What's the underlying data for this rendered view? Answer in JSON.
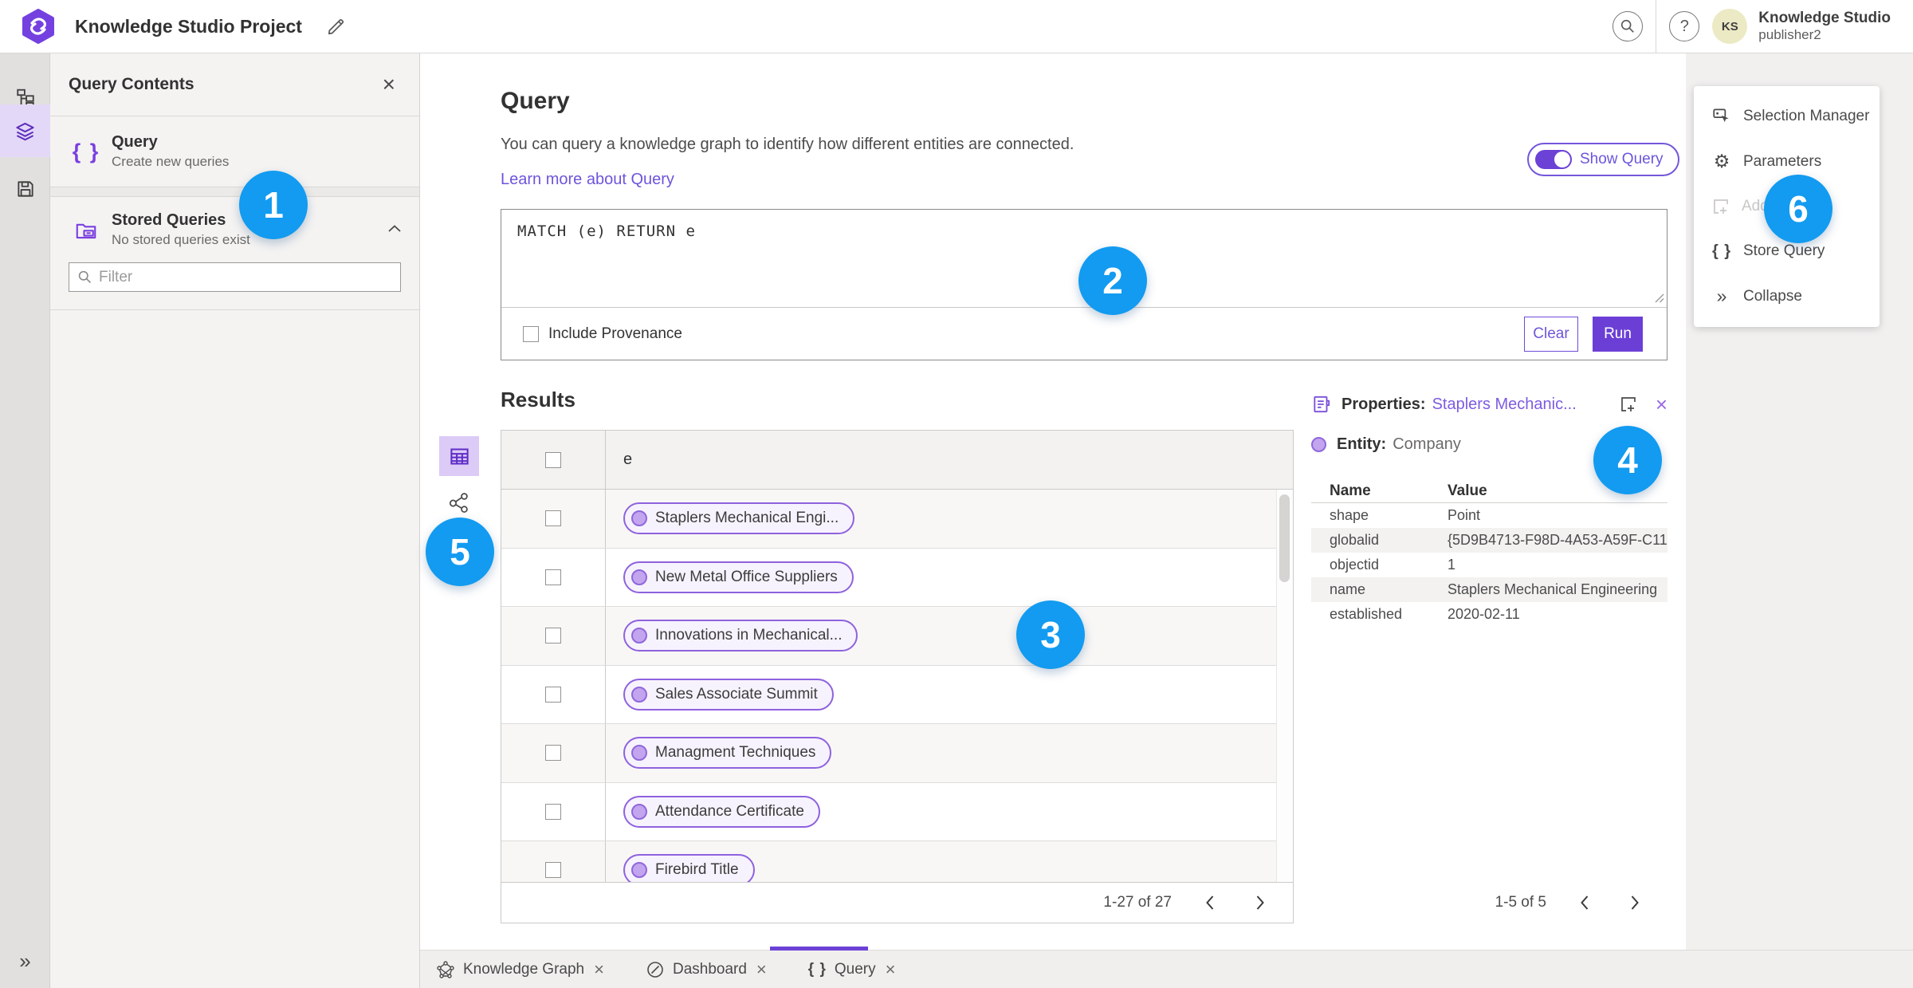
{
  "colors": {
    "accent_purple": "#6C41D6",
    "link_purple": "#6D55DB",
    "pill_border": "#8E62DD",
    "pill_dot": "#C3A4EE",
    "selected_light_purple": "#DCCBF6",
    "annotation_blue": "#129BF0",
    "avatar_bg": "#ECEAC4"
  },
  "icons": {
    "braces": "{ }",
    "close": "×",
    "collapse_chevrons": "»",
    "gear": "⚙",
    "question_mark": "?"
  },
  "topbar": {
    "title": "Knowledge Studio Project",
    "user_name": "Knowledge Studio",
    "user_sub": "publisher2",
    "avatar_initials": "KS"
  },
  "query_contents": {
    "title": "Query Contents",
    "query_item": {
      "title": "Query",
      "subtitle": "Create new queries"
    },
    "stored_item": {
      "title": "Stored Queries",
      "subtitle": "No stored queries exist"
    },
    "filter_placeholder": "Filter"
  },
  "query_section": {
    "title": "Query",
    "description": "You can query a knowledge graph to identify how different entities are connected.",
    "learn_more": "Learn more about Query",
    "show_query_label": "Show Query",
    "query_text": "MATCH (e) RETURN e",
    "include_provenance_label": "Include Provenance",
    "clear_label": "Clear",
    "run_label": "Run"
  },
  "results": {
    "title": "Results",
    "column_header": "e",
    "rows": [
      {
        "label": "Staplers Mechanical Engi..."
      },
      {
        "label": "New Metal Office Suppliers"
      },
      {
        "label": "Innovations in Mechanical..."
      },
      {
        "label": "Sales Associate Summit"
      },
      {
        "label": "Managment Techniques"
      },
      {
        "label": "Attendance Certificate"
      },
      {
        "label": "Firebird Title"
      }
    ],
    "pagination": "1-27 of 27"
  },
  "properties": {
    "heading": "Properties:",
    "entity_link": "Staplers Mechanic...",
    "entity_label": "Entity:",
    "entity_type": "Company",
    "columns": {
      "name": "Name",
      "value": "Value"
    },
    "rows": [
      {
        "name": "shape",
        "value": "Point"
      },
      {
        "name": "globalid",
        "value": "{5D9B4713-F98D-4A53-A59F-C11..."
      },
      {
        "name": "objectid",
        "value": "1"
      },
      {
        "name": "name",
        "value": "Staplers Mechanical Engineering"
      },
      {
        "name": "established",
        "value": "2020-02-11"
      }
    ],
    "pagination": "1-5 of 5"
  },
  "right_menu": {
    "items": [
      {
        "label": "Selection Manager"
      },
      {
        "label": "Parameters"
      },
      {
        "label": "Add",
        "disabled": true
      },
      {
        "label": "Store Query"
      },
      {
        "label": "Collapse"
      }
    ]
  },
  "bottom_tabs": [
    {
      "label": "Knowledge Graph"
    },
    {
      "label": "Dashboard"
    },
    {
      "label": "Query",
      "active": true
    }
  ],
  "annotations": [
    "1",
    "2",
    "3",
    "4",
    "5",
    "6"
  ]
}
